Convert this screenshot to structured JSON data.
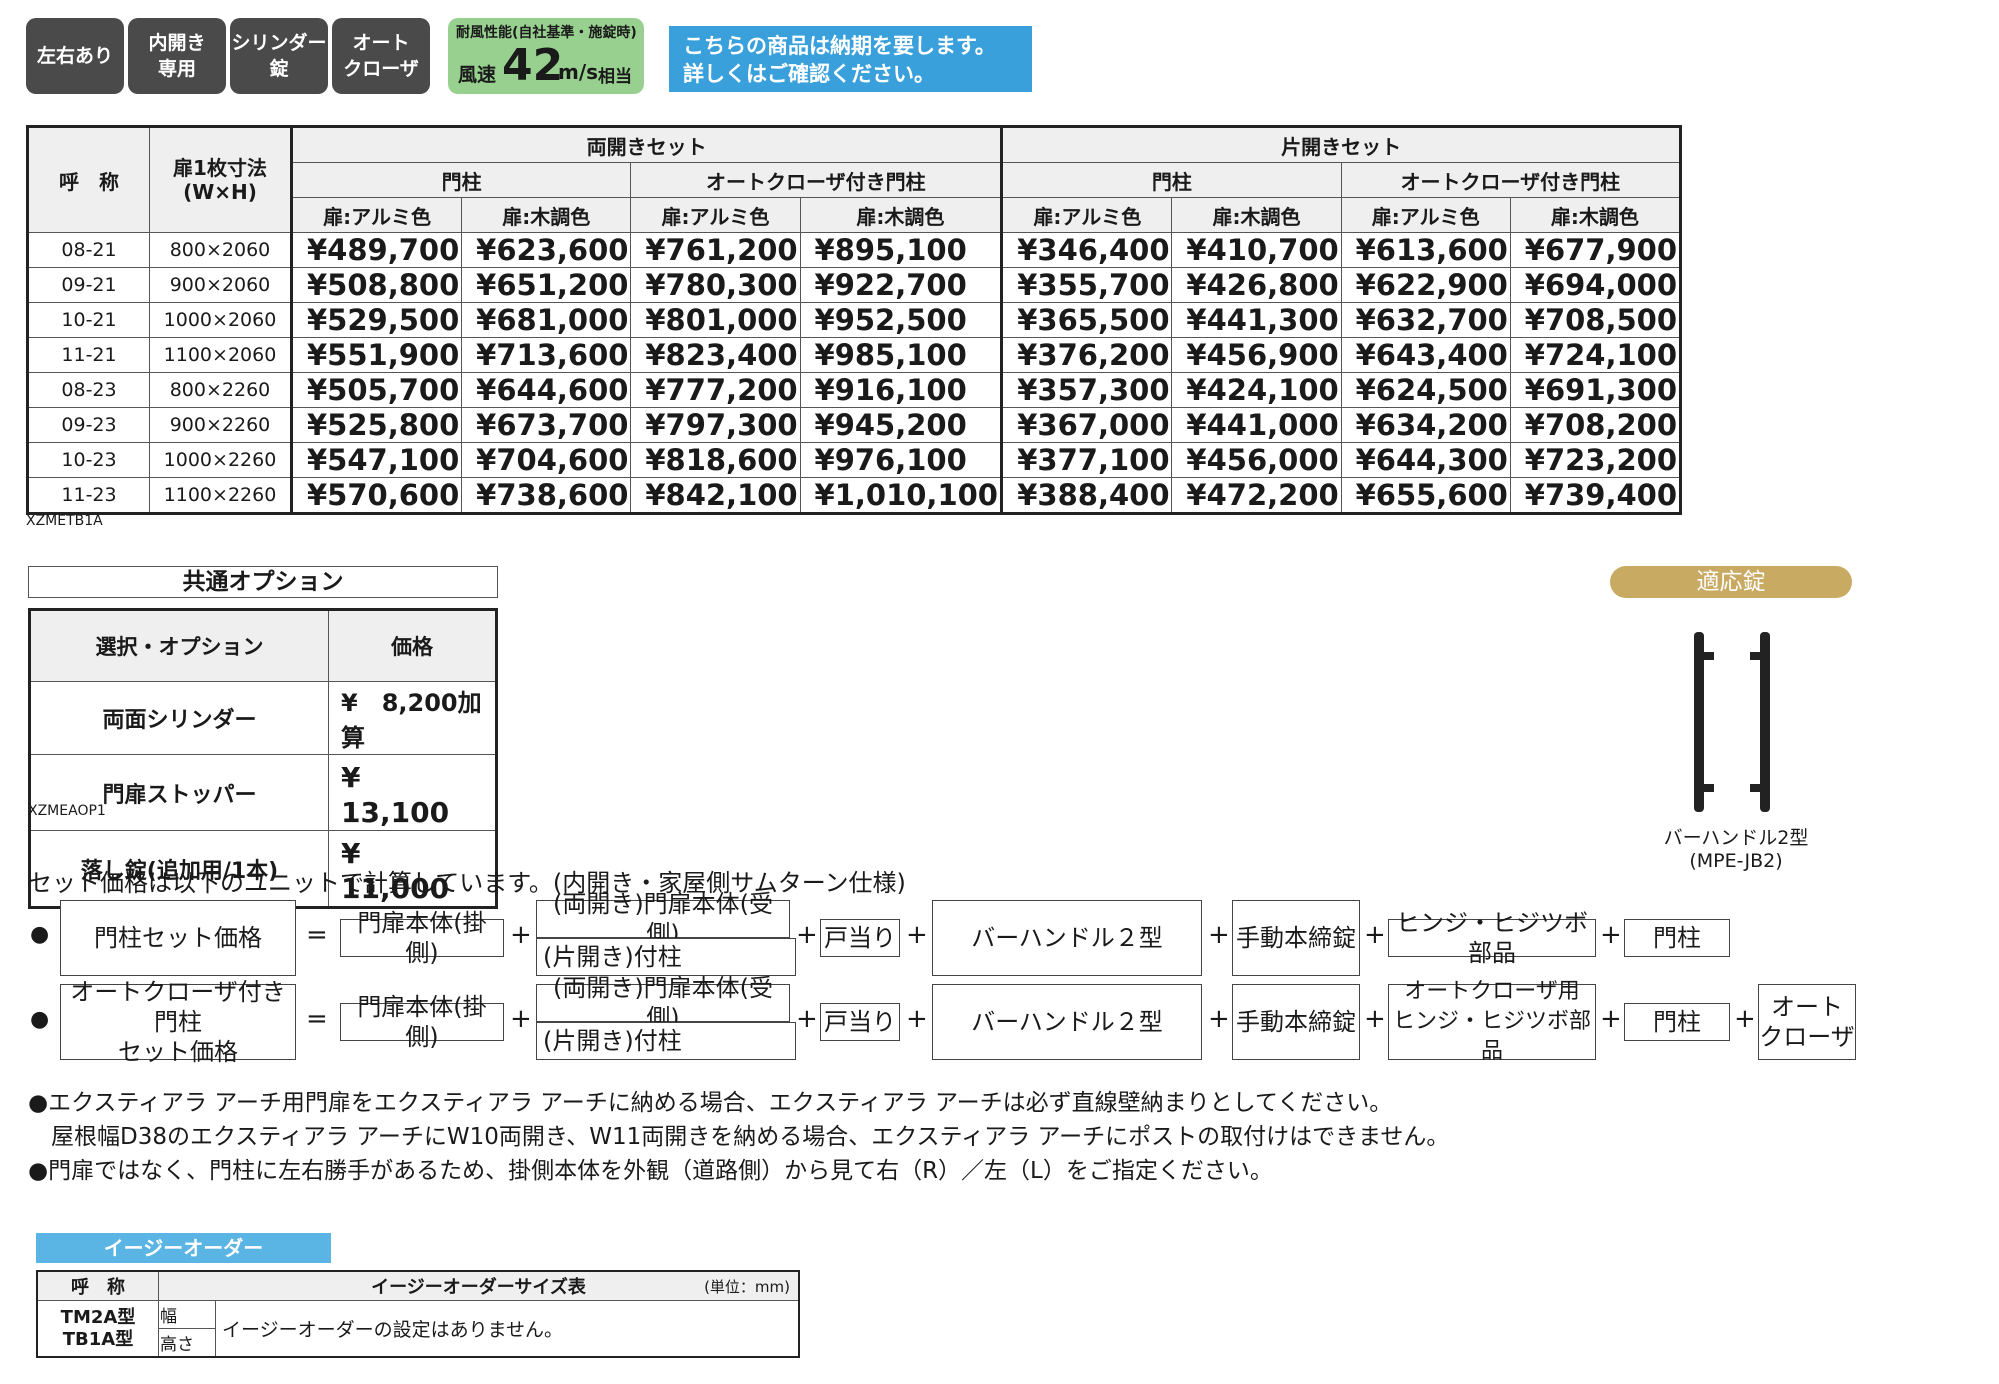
{
  "badges": [
    "左右あり",
    "内開き\n専用",
    "シリンダー\n錠",
    "オート\nクローザ"
  ],
  "wind": {
    "line1": "耐風性能(自社基準・施錠時)",
    "prefix": "風速",
    "value": "42",
    "unit": "m/s",
    "suffix": "相当"
  },
  "notice": "こちらの商品は納期を要します。\n詳しくはご確認ください。",
  "price_table": {
    "h_code": "呼　称",
    "h_size": "扉1枚寸法\n(W×H)",
    "h_double": "両開きセット",
    "h_single": "片開きセット",
    "h_post": "門柱",
    "h_auto": "オートクローザ付き門柱",
    "h_alu": "扉:アルミ色",
    "h_wood": "扉:木調色",
    "rows": [
      {
        "code": "08-21",
        "size": "800×2060",
        "v": [
          "¥489,700",
          "¥623,600",
          "¥761,200",
          "¥895,100",
          "¥346,400",
          "¥410,700",
          "¥613,600",
          "¥677,900"
        ]
      },
      {
        "code": "09-21",
        "size": "900×2060",
        "v": [
          "¥508,800",
          "¥651,200",
          "¥780,300",
          "¥922,700",
          "¥355,700",
          "¥426,800",
          "¥622,900",
          "¥694,000"
        ]
      },
      {
        "code": "10-21",
        "size": "1000×2060",
        "v": [
          "¥529,500",
          "¥681,000",
          "¥801,000",
          "¥952,500",
          "¥365,500",
          "¥441,300",
          "¥632,700",
          "¥708,500"
        ]
      },
      {
        "code": "11-21",
        "size": "1100×2060",
        "v": [
          "¥551,900",
          "¥713,600",
          "¥823,400",
          "¥985,100",
          "¥376,200",
          "¥456,900",
          "¥643,400",
          "¥724,100"
        ]
      },
      {
        "code": "08-23",
        "size": "800×2260",
        "v": [
          "¥505,700",
          "¥644,600",
          "¥777,200",
          "¥916,100",
          "¥357,300",
          "¥424,100",
          "¥624,500",
          "¥691,300"
        ]
      },
      {
        "code": "09-23",
        "size": "900×2260",
        "v": [
          "¥525,800",
          "¥673,700",
          "¥797,300",
          "¥945,200",
          "¥367,000",
          "¥441,000",
          "¥634,200",
          "¥708,200"
        ]
      },
      {
        "code": "10-23",
        "size": "1000×2260",
        "v": [
          "¥547,100",
          "¥704,600",
          "¥818,600",
          "¥976,100",
          "¥377,100",
          "¥456,000",
          "¥644,300",
          "¥723,200"
        ]
      },
      {
        "code": "11-23",
        "size": "1100×2260",
        "v": [
          "¥570,600",
          "¥738,600",
          "¥842,100",
          "¥1,010,100",
          "¥388,400",
          "¥472,200",
          "¥655,600",
          "¥739,400"
        ]
      }
    ],
    "code_note": "XZMETB1A"
  },
  "options": {
    "title": "共通オプション",
    "h_name": "選択・オプション",
    "h_price": "価格",
    "rows": [
      {
        "name": "両面シリンダー",
        "price": "¥　8,200加算"
      },
      {
        "name": "門扉ストッパー",
        "price": "¥　13,100"
      },
      {
        "name": "落し錠(追加用/1本)",
        "price": "¥　11,000"
      }
    ],
    "code_note": "XZMEAOP1"
  },
  "lock": {
    "title": "適応錠",
    "name": "バーハンドル2型",
    "model": "(MPE-JB2)"
  },
  "formula": {
    "intro": "セット価格は以下のユニットで計算しています。(内開き・家屋側サムターン仕様)",
    "bullet": "●",
    "eq": "=",
    "plus": "+",
    "row1": {
      "label": "門柱セット価格",
      "body": "門扉本体(掛側)",
      "receiver": "(両開き)門扉本体(受側)",
      "single": "(片開き)付柱",
      "stop": "戸当り",
      "handle": "バーハンドル２型",
      "lock": "手動本締錠",
      "hinge": "ヒンジ・ヒジツボ部品",
      "post": "門柱"
    },
    "row2": {
      "label": "オートクローザ付き門柱\nセット価格",
      "body": "門扉本体(掛側)",
      "receiver": "(両開き)門扉本体(受側)",
      "single": "(片開き)付柱",
      "stop": "戸当り",
      "handle": "バーハンドル２型",
      "lock": "手動本締錠",
      "hinge": "オートクローザ用\nヒンジ・ヒジツボ部品",
      "post": "門柱",
      "closer": "オート\nクローザ"
    }
  },
  "notes": [
    "●エクスティアラ アーチ用門扉をエクスティアラ アーチに納める場合、エクスティアラ アーチは必ず直線壁納まりとしてください。",
    "　屋根幅D38のエクスティアラ アーチにW10両開き、W11両開きを納める場合、エクスティアラ アーチにポストの取付けはできません。",
    "●門扉ではなく、門柱に左右勝手があるため、掛側本体を外観（道路側）から見て右（R）／左（L）をご指定ください。"
  ],
  "easy": {
    "title": "イージーオーダー",
    "h_code": "呼　称",
    "h_table": "イージーオーダーサイズ表",
    "h_unit": "(単位：mm)",
    "model1": "TM2A型",
    "model2": "TB1A型",
    "w": "幅",
    "h": "高さ",
    "msg": "イージーオーダーの設定はありません。"
  }
}
